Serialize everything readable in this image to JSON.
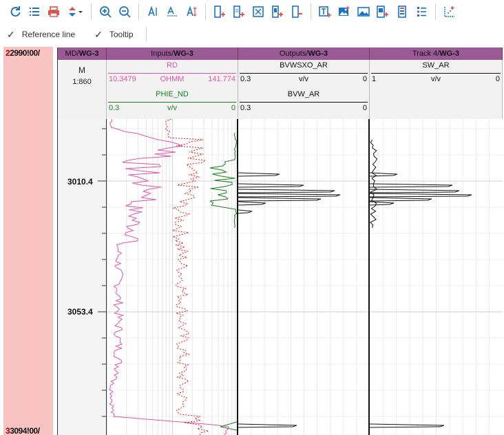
{
  "toolbar": {
    "buttons": [
      {
        "name": "refresh-icon",
        "color": "#1a73c8"
      },
      {
        "name": "list-icon",
        "color": "#1a73c8"
      },
      {
        "name": "print-icon",
        "color": "#d9534f"
      },
      {
        "name": "sort-dropdown-icon",
        "color": "#1a73c8"
      },
      {
        "name": "zoom-in-icon",
        "color": "#1a73c8"
      },
      {
        "name": "zoom-out-icon",
        "color": "#1a73c8"
      },
      {
        "name": "text-align-icon",
        "color": "#1a73c8"
      },
      {
        "name": "text-spacing-icon",
        "color": "#1a73c8"
      },
      {
        "name": "text-height-icon",
        "color": "#1a73c8"
      },
      {
        "name": "add-track-icon",
        "color": "#1a73c8"
      },
      {
        "name": "add-track-alt-icon",
        "color": "#1a73c8"
      },
      {
        "name": "track-grid-icon",
        "color": "#1a73c8"
      },
      {
        "name": "add-curve-icon",
        "color": "#1a73c8"
      },
      {
        "name": "remove-track-icon",
        "color": "#1a73c8"
      },
      {
        "name": "add-text-icon",
        "color": "#1a73c8"
      },
      {
        "name": "insert-image-icon",
        "color": "#1a73c8"
      },
      {
        "name": "image-icon",
        "color": "#1a73c8"
      },
      {
        "name": "add-image-icon",
        "color": "#1a73c8"
      },
      {
        "name": "table-icon",
        "color": "#1a73c8"
      },
      {
        "name": "list-view-icon",
        "color": "#1a73c8"
      },
      {
        "name": "crossplot-icon",
        "color": "#1a73c8"
      }
    ]
  },
  "options": {
    "reference_line": "Reference line",
    "tooltip": "Tooltip",
    "check": "✓"
  },
  "overview": {
    "top_label_a": "2",
    "top_label_b": "2990",
    "top_label_c": "!00/",
    "bottom_label_a": "3",
    "bottom_label_b": "3094",
    "bottom_label_c": "!00/"
  },
  "tracks": {
    "md": {
      "title_a": "MD/",
      "title_b": "WG-3",
      "unit": "M",
      "scale": "1:860"
    },
    "inputs": {
      "title_a": "Inputs/",
      "title_b": "WG-3"
    },
    "outputs": {
      "title_a": "Outputs/",
      "title_b": "WG-3"
    },
    "track4": {
      "title_a": "Track 4/",
      "title_b": "WG-3"
    }
  },
  "curves": {
    "rd": {
      "name": "RD",
      "min": "10.3479",
      "unit": "OHMM",
      "max": "141.774",
      "color": "#e055a8"
    },
    "phie": {
      "name": "PHIE_ND",
      "min": "0.3",
      "unit": "v/v",
      "max": "0",
      "color": "#1a7f1a"
    },
    "bvwsxo": {
      "name": "BVWSXO_AR",
      "min": "0.3",
      "unit": "v/v",
      "max": "0",
      "color": "#000000"
    },
    "bvw": {
      "name": "BVW_AR",
      "min": "0.3",
      "unit": "",
      "max": "0",
      "color": "#000000"
    },
    "sw": {
      "name": "SW_AR",
      "min": "1",
      "unit": "v/v",
      "max": "0",
      "color": "#000000"
    }
  },
  "depths": {
    "d1": "3010.4",
    "d2": "3053.4"
  },
  "colors": {
    "header_purple": "#9b5a96",
    "overview_pink": "#f9c3c2",
    "rd_dotted": "#e0201a"
  }
}
